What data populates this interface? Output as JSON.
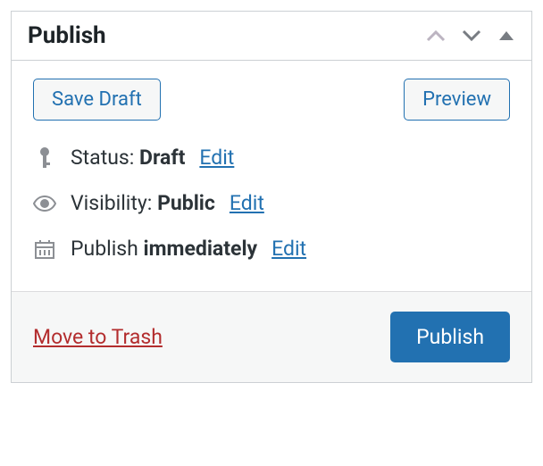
{
  "panel": {
    "title": "Publish"
  },
  "actions": {
    "save_draft": "Save Draft",
    "preview": "Preview"
  },
  "status": {
    "label": "Status: ",
    "value": "Draft",
    "edit": "Edit"
  },
  "visibility": {
    "label": "Visibility: ",
    "value": "Public",
    "edit": "Edit"
  },
  "schedule": {
    "label": "Publish ",
    "value": "immediately",
    "edit": "Edit"
  },
  "footer": {
    "trash": "Move to Trash",
    "publish": "Publish"
  }
}
